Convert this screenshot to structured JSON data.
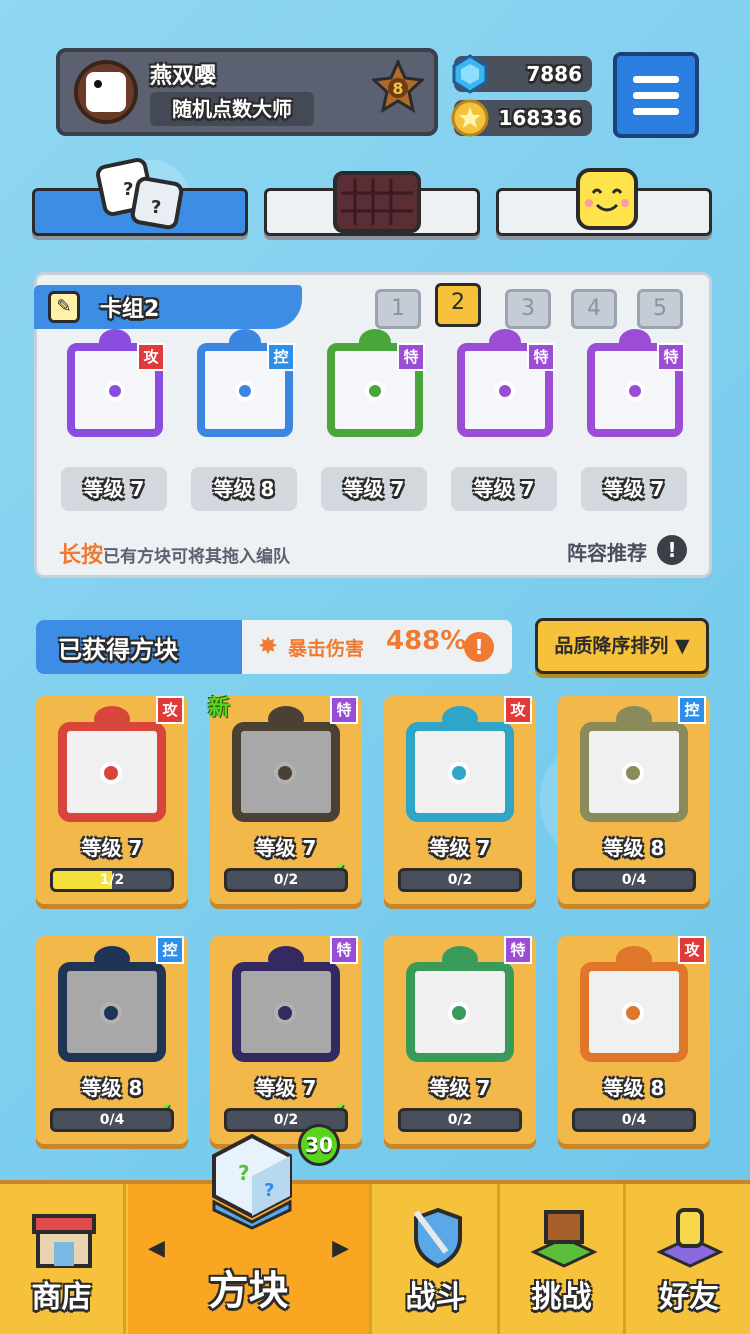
{
  "profile": {
    "name": "燕双嘤",
    "title": "随机点数大师",
    "rank": "8"
  },
  "currency": {
    "gems": "7886",
    "coins": "168336"
  },
  "deck": {
    "title": "卡组2",
    "slots": [
      "1",
      "2",
      "3",
      "4",
      "5"
    ],
    "active_slot": "2",
    "cards": [
      {
        "tag": "攻",
        "level": "等级 7",
        "color": "#8a4de0"
      },
      {
        "tag": "控",
        "level": "等级 8",
        "color": "#3b86e0"
      },
      {
        "tag": "特",
        "level": "等级 7",
        "color": "#4aa63b"
      },
      {
        "tag": "特",
        "level": "等级 7",
        "color": "#9b4dd6"
      },
      {
        "tag": "特",
        "level": "等级 7",
        "color": "#9b4dd6"
      }
    ],
    "hint_prefix": "长按",
    "hint_text": "已有方块可将其拖入编队",
    "recommend": "阵容推荐"
  },
  "acquired": {
    "title": "已获得方块",
    "crit_label": "暴击伤害",
    "crit_value": "488%",
    "sort_label": "品质降序排列 ▼",
    "new_label": "新",
    "blocks": [
      {
        "tag": "攻",
        "level": "等级 7",
        "progress": "1/2",
        "fill": 0.5,
        "color": "#d8453a",
        "checked": false,
        "is_new": false
      },
      {
        "tag": "特",
        "level": "等级 7",
        "progress": "0/2",
        "fill": 0,
        "color": "#6a5b4a",
        "checked": true,
        "is_new": true
      },
      {
        "tag": "攻",
        "level": "等级 7",
        "progress": "0/2",
        "fill": 0,
        "color": "#2fa6c8",
        "checked": false,
        "is_new": false
      },
      {
        "tag": "控",
        "level": "等级 8",
        "progress": "0/4",
        "fill": 0,
        "color": "#8a8a5a",
        "checked": false,
        "is_new": false
      },
      {
        "tag": "控",
        "level": "等级 8",
        "progress": "0/4",
        "fill": 0,
        "color": "#2e4a7a",
        "checked": true,
        "is_new": false
      },
      {
        "tag": "特",
        "level": "等级 7",
        "progress": "0/2",
        "fill": 0,
        "color": "#4a3a8a",
        "checked": true,
        "is_new": false
      },
      {
        "tag": "特",
        "level": "等级 7",
        "progress": "0/2",
        "fill": 0,
        "color": "#3a9a5a",
        "checked": false,
        "is_new": false
      },
      {
        "tag": "攻",
        "level": "等级 8",
        "progress": "0/4",
        "fill": 0,
        "color": "#e0762a",
        "checked": false,
        "is_new": false
      }
    ]
  },
  "nav": {
    "shop": "商店",
    "blocks": "方块",
    "battle": "战斗",
    "challenge": "挑战",
    "friends": "好友",
    "badge": "30"
  }
}
